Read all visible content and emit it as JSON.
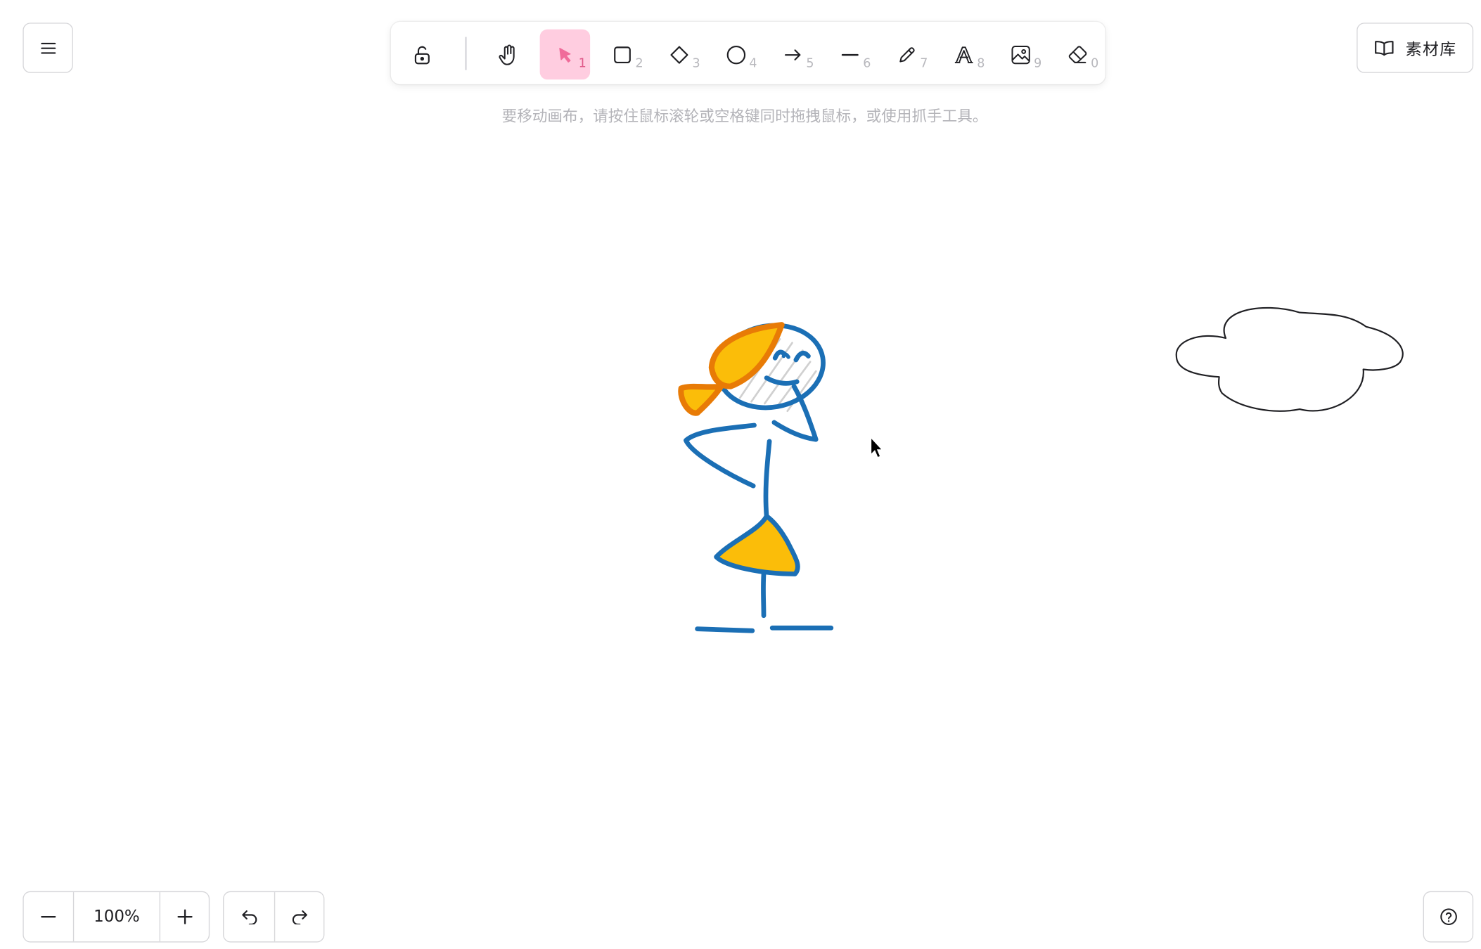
{
  "header": {
    "menu_icon": "hamburger-menu-icon",
    "library": {
      "label": "素材库",
      "icon": "book-open-icon"
    }
  },
  "toolbar": {
    "lock_icon": "unlock-icon",
    "tools": [
      {
        "name": "hand",
        "icon": "hand-icon",
        "shortcut": ""
      },
      {
        "name": "selection",
        "icon": "pointer-icon",
        "shortcut": "1",
        "active": true
      },
      {
        "name": "rectangle",
        "icon": "square-icon",
        "shortcut": "2"
      },
      {
        "name": "diamond",
        "icon": "diamond-icon",
        "shortcut": "3"
      },
      {
        "name": "ellipse",
        "icon": "circle-icon",
        "shortcut": "4"
      },
      {
        "name": "arrow",
        "icon": "arrow-right-icon",
        "shortcut": "5"
      },
      {
        "name": "line",
        "icon": "line-icon",
        "shortcut": "6"
      },
      {
        "name": "draw",
        "icon": "pencil-icon",
        "shortcut": "7"
      },
      {
        "name": "text",
        "icon": "text-icon",
        "shortcut": "8"
      },
      {
        "name": "image",
        "icon": "image-icon",
        "shortcut": "9"
      },
      {
        "name": "eraser",
        "icon": "eraser-icon",
        "shortcut": "0"
      }
    ],
    "active_color": "#ffcde0"
  },
  "hint": "要移动画布，请按住鼠标滚轮或空格键同时拖拽鼠标，或使用抓手工具。",
  "footer": {
    "zoom_level": "100%",
    "zoom_out_icon": "minus-icon",
    "zoom_in_icon": "plus-icon",
    "undo_icon": "undo-icon",
    "redo_icon": "redo-icon",
    "help_icon": "help-circle-icon"
  },
  "canvas": {
    "drawings": [
      "stick-figure",
      "cloud"
    ],
    "colors": {
      "stroke_blue": "#1b6fb5",
      "fill_yellow": "#fbbd09",
      "stroke_orange": "#e87b06"
    }
  }
}
